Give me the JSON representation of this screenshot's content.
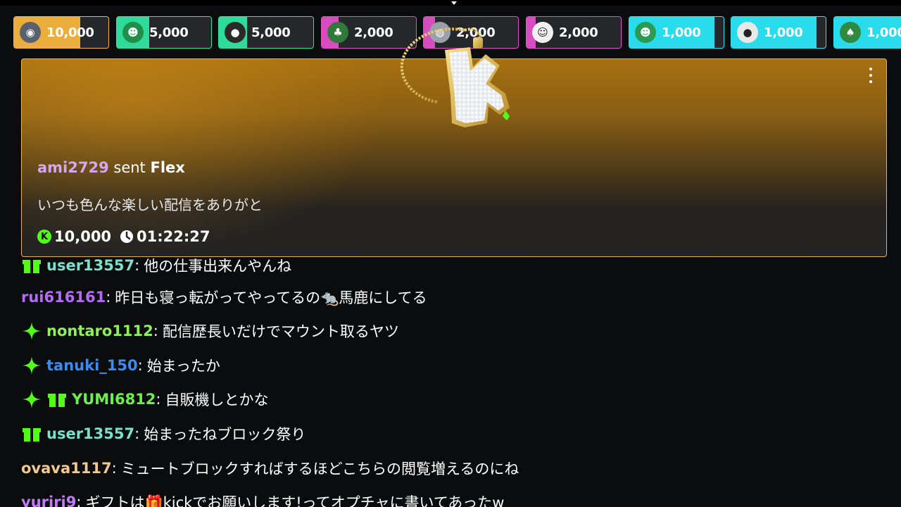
{
  "colors": {
    "kick_green": "#53fc18",
    "gold_border": "#e8b446",
    "username_purple": "#d6a6f0"
  },
  "gift_pills": [
    {
      "amount": "10,000",
      "avatar_icon": "avatar-helmet-icon",
      "fill_color": "#f5b53d",
      "fill_fraction": 0.7
    },
    {
      "amount": "5,000",
      "avatar_icon": "avatar-green-face-icon",
      "fill_color": "#2ee5a0",
      "fill_fraction": 0.34
    },
    {
      "amount": "5,000",
      "avatar_icon": "avatar-mouse-icon",
      "fill_color": "#2ee5a0",
      "fill_fraction": 0.3
    },
    {
      "amount": "2,000",
      "avatar_icon": "avatar-green-hat-icon",
      "fill_color": "#e04fc7",
      "fill_fraction": 0.18
    },
    {
      "amount": "2,000",
      "avatar_icon": "avatar-silver-icon",
      "fill_color": "#e04fc7",
      "fill_fraction": 0.12
    },
    {
      "amount": "2,000",
      "avatar_icon": "avatar-cartoon-icon",
      "fill_color": "#e04fc7",
      "fill_fraction": 0.1
    },
    {
      "amount": "1,000",
      "avatar_icon": "avatar-green-icon",
      "fill_color": "#28e6f5",
      "fill_fraction": 0.9
    },
    {
      "amount": "1,000",
      "avatar_icon": "avatar-white-icon",
      "fill_color": "#28e6f5",
      "fill_fraction": 0.9
    },
    {
      "amount": "1,000",
      "avatar_icon": "avatar-green-blob-icon",
      "fill_color": "#28e6f5",
      "fill_fraction": 0.9
    }
  ],
  "featured_gift": {
    "username": "ami2729",
    "verb": "sent",
    "gift_name": "Flex",
    "message": "いつも色んな楽しい配信をありがと",
    "amount": "10,000",
    "coin_letter": "K",
    "timer": "01:22:27",
    "more_icon": "more-vertical-icon"
  },
  "chat": {
    "messages": [
      {
        "badges": [
          "gift"
        ],
        "username": "user13557",
        "color": "#7ee0cc",
        "sep": ":",
        "text": "他の仕事出来んやんね"
      },
      {
        "badges": [],
        "username": "rui616161",
        "color": "#b46cf5",
        "sep": ":",
        "text": "昨日も寝っ転がってやってるの🐀馬鹿にしてる"
      },
      {
        "badges": [
          "sparkle"
        ],
        "username": "nontaro1112",
        "color": "#8ef05a",
        "sep": ":",
        "text": "配信歴長いだけでマウント取るヤツ"
      },
      {
        "badges": [
          "sparkle"
        ],
        "username": "tanuki_150",
        "color": "#3c8cf0",
        "sep": ":",
        "text": "始まったか"
      },
      {
        "badges": [
          "sparkle",
          "gift"
        ],
        "username": "YUMI6812",
        "color": "#6ef04a",
        "sep": ":",
        "text": "自販機しとかな"
      },
      {
        "badges": [
          "gift"
        ],
        "username": "user13557",
        "color": "#7ee0cc",
        "sep": ":",
        "text": "始まったねブロック祭り"
      },
      {
        "badges": [],
        "username": "ovava1117",
        "color": "#f0c890",
        "sep": ":",
        "text": "ミュートブロックすればするほどこちらの閲覧増えるのにね"
      },
      {
        "badges": [],
        "username": "yuriri9",
        "color": "#c07cf5",
        "sep": ":",
        "text": "ギフトは🎁kickでお願いします!ってオプチャに書いてあったw"
      }
    ]
  }
}
